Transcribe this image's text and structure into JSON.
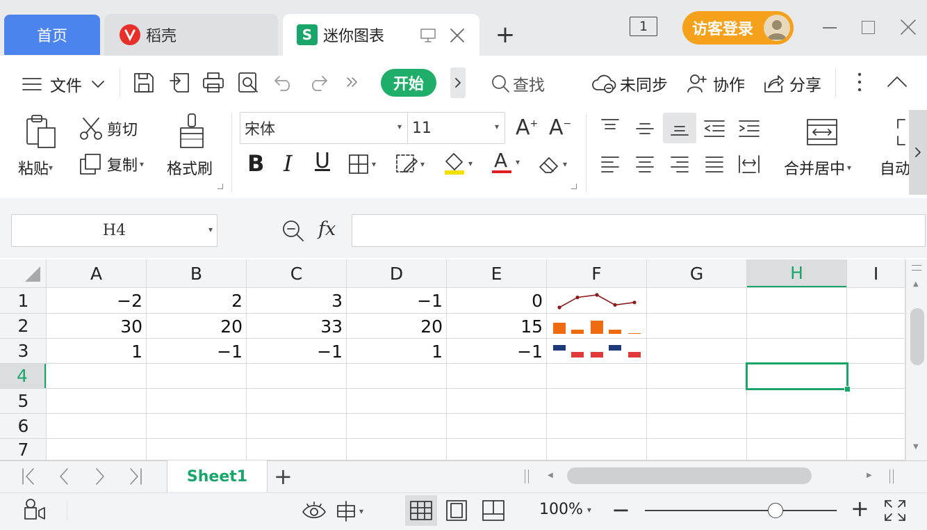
{
  "tabs": {
    "home": "首页",
    "daoke": "稻壳",
    "mini_chart": "迷你图表",
    "new_tab": "+"
  },
  "window": {
    "page_indicator": "1",
    "login": "访客登录"
  },
  "menubar": {
    "file": "文件",
    "start": "开始",
    "search": "查找",
    "sync": "未同步",
    "collab": "协作",
    "share": "分享"
  },
  "ribbon": {
    "paste": "粘贴",
    "cut": "剪切",
    "copy": "复制",
    "format_painter": "格式刷",
    "font_name": "宋体",
    "font_size": "11",
    "bold": "B",
    "italic": "I",
    "underline": "U",
    "font_color": "A",
    "merge_center": "合并居中",
    "auto": "自动"
  },
  "formula_bar": {
    "name_box": "H4",
    "fx": "fx",
    "formula": ""
  },
  "sheet": {
    "columns": [
      "A",
      "B",
      "C",
      "D",
      "E",
      "F",
      "G",
      "H",
      "I"
    ],
    "selected_column": "H",
    "rows": [
      "1",
      "2",
      "3",
      "4",
      "5",
      "6",
      "7"
    ],
    "selected_row": "4",
    "cells": [
      [
        "−2",
        "2",
        "3",
        "−1",
        "0"
      ],
      [
        "30",
        "20",
        "33",
        "20",
        "15"
      ],
      [
        "1",
        "−1",
        "−1",
        "1",
        "−1"
      ]
    ],
    "active_cell": "H4"
  },
  "sparklines": {
    "line": {
      "values": [
        -2,
        2,
        3,
        -1,
        0
      ],
      "color": "#8b1a1a"
    },
    "column": {
      "values": [
        30,
        20,
        33,
        20,
        15
      ],
      "color": "#f06a10"
    },
    "winloss": {
      "values": [
        1,
        -1,
        -1,
        1,
        -1
      ],
      "win_color": "#1f3a78",
      "loss_color": "#e03a3a"
    }
  },
  "sheet_tabs": {
    "active": "Sheet1",
    "add": "+"
  },
  "statusbar": {
    "zoom": "100%",
    "zoom_out": "−",
    "zoom_in": "+",
    "zoom_level": 0.68
  },
  "colors": {
    "accent_green": "#1fae6a",
    "home_tab_blue": "#4b84ec",
    "login_orange": "#f6a11b"
  }
}
